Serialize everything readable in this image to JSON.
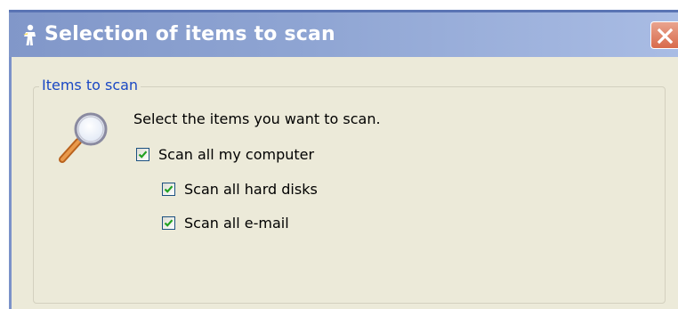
{
  "window": {
    "title": "Selection of items to scan",
    "title_icon": "app-figure-icon",
    "close_icon": "close-icon",
    "colors": {
      "titlebar": "#8fa5d3",
      "client": "#ecead9",
      "close": "#d86a4b",
      "legend_text": "#1a48c4"
    }
  },
  "group": {
    "legend": "Items to scan",
    "icon": "magnifier-icon",
    "instruction": "Select the items you want to scan.",
    "options": [
      {
        "label": "Scan all my computer",
        "checked": true
      },
      {
        "label": "Scan all hard disks",
        "checked": true
      },
      {
        "label": "Scan all e-mail",
        "checked": true
      }
    ]
  }
}
